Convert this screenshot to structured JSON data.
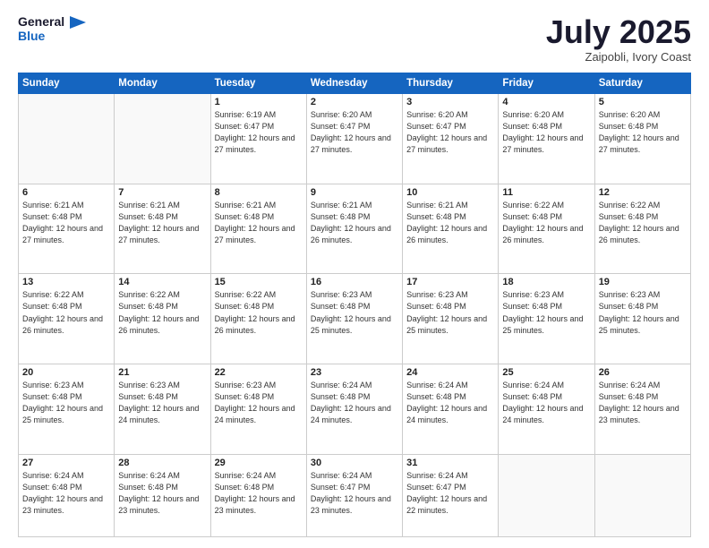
{
  "logo": {
    "line1": "General",
    "line2": "Blue"
  },
  "header": {
    "month": "July 2025",
    "location": "Zaipobli, Ivory Coast"
  },
  "weekdays": [
    "Sunday",
    "Monday",
    "Tuesday",
    "Wednesday",
    "Thursday",
    "Friday",
    "Saturday"
  ],
  "weeks": [
    [
      {
        "day": "",
        "info": ""
      },
      {
        "day": "",
        "info": ""
      },
      {
        "day": "1",
        "info": "Sunrise: 6:19 AM\nSunset: 6:47 PM\nDaylight: 12 hours and 27 minutes."
      },
      {
        "day": "2",
        "info": "Sunrise: 6:20 AM\nSunset: 6:47 PM\nDaylight: 12 hours and 27 minutes."
      },
      {
        "day": "3",
        "info": "Sunrise: 6:20 AM\nSunset: 6:47 PM\nDaylight: 12 hours and 27 minutes."
      },
      {
        "day": "4",
        "info": "Sunrise: 6:20 AM\nSunset: 6:48 PM\nDaylight: 12 hours and 27 minutes."
      },
      {
        "day": "5",
        "info": "Sunrise: 6:20 AM\nSunset: 6:48 PM\nDaylight: 12 hours and 27 minutes."
      }
    ],
    [
      {
        "day": "6",
        "info": "Sunrise: 6:21 AM\nSunset: 6:48 PM\nDaylight: 12 hours and 27 minutes."
      },
      {
        "day": "7",
        "info": "Sunrise: 6:21 AM\nSunset: 6:48 PM\nDaylight: 12 hours and 27 minutes."
      },
      {
        "day": "8",
        "info": "Sunrise: 6:21 AM\nSunset: 6:48 PM\nDaylight: 12 hours and 27 minutes."
      },
      {
        "day": "9",
        "info": "Sunrise: 6:21 AM\nSunset: 6:48 PM\nDaylight: 12 hours and 26 minutes."
      },
      {
        "day": "10",
        "info": "Sunrise: 6:21 AM\nSunset: 6:48 PM\nDaylight: 12 hours and 26 minutes."
      },
      {
        "day": "11",
        "info": "Sunrise: 6:22 AM\nSunset: 6:48 PM\nDaylight: 12 hours and 26 minutes."
      },
      {
        "day": "12",
        "info": "Sunrise: 6:22 AM\nSunset: 6:48 PM\nDaylight: 12 hours and 26 minutes."
      }
    ],
    [
      {
        "day": "13",
        "info": "Sunrise: 6:22 AM\nSunset: 6:48 PM\nDaylight: 12 hours and 26 minutes."
      },
      {
        "day": "14",
        "info": "Sunrise: 6:22 AM\nSunset: 6:48 PM\nDaylight: 12 hours and 26 minutes."
      },
      {
        "day": "15",
        "info": "Sunrise: 6:22 AM\nSunset: 6:48 PM\nDaylight: 12 hours and 26 minutes."
      },
      {
        "day": "16",
        "info": "Sunrise: 6:23 AM\nSunset: 6:48 PM\nDaylight: 12 hours and 25 minutes."
      },
      {
        "day": "17",
        "info": "Sunrise: 6:23 AM\nSunset: 6:48 PM\nDaylight: 12 hours and 25 minutes."
      },
      {
        "day": "18",
        "info": "Sunrise: 6:23 AM\nSunset: 6:48 PM\nDaylight: 12 hours and 25 minutes."
      },
      {
        "day": "19",
        "info": "Sunrise: 6:23 AM\nSunset: 6:48 PM\nDaylight: 12 hours and 25 minutes."
      }
    ],
    [
      {
        "day": "20",
        "info": "Sunrise: 6:23 AM\nSunset: 6:48 PM\nDaylight: 12 hours and 25 minutes."
      },
      {
        "day": "21",
        "info": "Sunrise: 6:23 AM\nSunset: 6:48 PM\nDaylight: 12 hours and 24 minutes."
      },
      {
        "day": "22",
        "info": "Sunrise: 6:23 AM\nSunset: 6:48 PM\nDaylight: 12 hours and 24 minutes."
      },
      {
        "day": "23",
        "info": "Sunrise: 6:24 AM\nSunset: 6:48 PM\nDaylight: 12 hours and 24 minutes."
      },
      {
        "day": "24",
        "info": "Sunrise: 6:24 AM\nSunset: 6:48 PM\nDaylight: 12 hours and 24 minutes."
      },
      {
        "day": "25",
        "info": "Sunrise: 6:24 AM\nSunset: 6:48 PM\nDaylight: 12 hours and 24 minutes."
      },
      {
        "day": "26",
        "info": "Sunrise: 6:24 AM\nSunset: 6:48 PM\nDaylight: 12 hours and 23 minutes."
      }
    ],
    [
      {
        "day": "27",
        "info": "Sunrise: 6:24 AM\nSunset: 6:48 PM\nDaylight: 12 hours and 23 minutes."
      },
      {
        "day": "28",
        "info": "Sunrise: 6:24 AM\nSunset: 6:48 PM\nDaylight: 12 hours and 23 minutes."
      },
      {
        "day": "29",
        "info": "Sunrise: 6:24 AM\nSunset: 6:48 PM\nDaylight: 12 hours and 23 minutes."
      },
      {
        "day": "30",
        "info": "Sunrise: 6:24 AM\nSunset: 6:47 PM\nDaylight: 12 hours and 23 minutes."
      },
      {
        "day": "31",
        "info": "Sunrise: 6:24 AM\nSunset: 6:47 PM\nDaylight: 12 hours and 22 minutes."
      },
      {
        "day": "",
        "info": ""
      },
      {
        "day": "",
        "info": ""
      }
    ]
  ]
}
